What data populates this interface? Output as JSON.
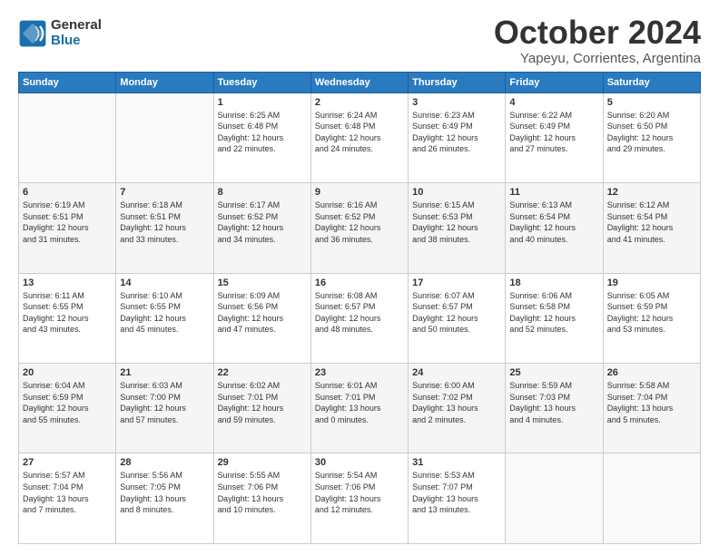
{
  "logo": {
    "general": "General",
    "blue": "Blue"
  },
  "title": "October 2024",
  "subtitle": "Yapeyu, Corrientes, Argentina",
  "header_days": [
    "Sunday",
    "Monday",
    "Tuesday",
    "Wednesday",
    "Thursday",
    "Friday",
    "Saturday"
  ],
  "weeks": [
    [
      {
        "day": "",
        "info": ""
      },
      {
        "day": "",
        "info": ""
      },
      {
        "day": "1",
        "info": "Sunrise: 6:25 AM\nSunset: 6:48 PM\nDaylight: 12 hours\nand 22 minutes."
      },
      {
        "day": "2",
        "info": "Sunrise: 6:24 AM\nSunset: 6:48 PM\nDaylight: 12 hours\nand 24 minutes."
      },
      {
        "day": "3",
        "info": "Sunrise: 6:23 AM\nSunset: 6:49 PM\nDaylight: 12 hours\nand 26 minutes."
      },
      {
        "day": "4",
        "info": "Sunrise: 6:22 AM\nSunset: 6:49 PM\nDaylight: 12 hours\nand 27 minutes."
      },
      {
        "day": "5",
        "info": "Sunrise: 6:20 AM\nSunset: 6:50 PM\nDaylight: 12 hours\nand 29 minutes."
      }
    ],
    [
      {
        "day": "6",
        "info": "Sunrise: 6:19 AM\nSunset: 6:51 PM\nDaylight: 12 hours\nand 31 minutes."
      },
      {
        "day": "7",
        "info": "Sunrise: 6:18 AM\nSunset: 6:51 PM\nDaylight: 12 hours\nand 33 minutes."
      },
      {
        "day": "8",
        "info": "Sunrise: 6:17 AM\nSunset: 6:52 PM\nDaylight: 12 hours\nand 34 minutes."
      },
      {
        "day": "9",
        "info": "Sunrise: 6:16 AM\nSunset: 6:52 PM\nDaylight: 12 hours\nand 36 minutes."
      },
      {
        "day": "10",
        "info": "Sunrise: 6:15 AM\nSunset: 6:53 PM\nDaylight: 12 hours\nand 38 minutes."
      },
      {
        "day": "11",
        "info": "Sunrise: 6:13 AM\nSunset: 6:54 PM\nDaylight: 12 hours\nand 40 minutes."
      },
      {
        "day": "12",
        "info": "Sunrise: 6:12 AM\nSunset: 6:54 PM\nDaylight: 12 hours\nand 41 minutes."
      }
    ],
    [
      {
        "day": "13",
        "info": "Sunrise: 6:11 AM\nSunset: 6:55 PM\nDaylight: 12 hours\nand 43 minutes."
      },
      {
        "day": "14",
        "info": "Sunrise: 6:10 AM\nSunset: 6:55 PM\nDaylight: 12 hours\nand 45 minutes."
      },
      {
        "day": "15",
        "info": "Sunrise: 6:09 AM\nSunset: 6:56 PM\nDaylight: 12 hours\nand 47 minutes."
      },
      {
        "day": "16",
        "info": "Sunrise: 6:08 AM\nSunset: 6:57 PM\nDaylight: 12 hours\nand 48 minutes."
      },
      {
        "day": "17",
        "info": "Sunrise: 6:07 AM\nSunset: 6:57 PM\nDaylight: 12 hours\nand 50 minutes."
      },
      {
        "day": "18",
        "info": "Sunrise: 6:06 AM\nSunset: 6:58 PM\nDaylight: 12 hours\nand 52 minutes."
      },
      {
        "day": "19",
        "info": "Sunrise: 6:05 AM\nSunset: 6:59 PM\nDaylight: 12 hours\nand 53 minutes."
      }
    ],
    [
      {
        "day": "20",
        "info": "Sunrise: 6:04 AM\nSunset: 6:59 PM\nDaylight: 12 hours\nand 55 minutes."
      },
      {
        "day": "21",
        "info": "Sunrise: 6:03 AM\nSunset: 7:00 PM\nDaylight: 12 hours\nand 57 minutes."
      },
      {
        "day": "22",
        "info": "Sunrise: 6:02 AM\nSunset: 7:01 PM\nDaylight: 12 hours\nand 59 minutes."
      },
      {
        "day": "23",
        "info": "Sunrise: 6:01 AM\nSunset: 7:01 PM\nDaylight: 13 hours\nand 0 minutes."
      },
      {
        "day": "24",
        "info": "Sunrise: 6:00 AM\nSunset: 7:02 PM\nDaylight: 13 hours\nand 2 minutes."
      },
      {
        "day": "25",
        "info": "Sunrise: 5:59 AM\nSunset: 7:03 PM\nDaylight: 13 hours\nand 4 minutes."
      },
      {
        "day": "26",
        "info": "Sunrise: 5:58 AM\nSunset: 7:04 PM\nDaylight: 13 hours\nand 5 minutes."
      }
    ],
    [
      {
        "day": "27",
        "info": "Sunrise: 5:57 AM\nSunset: 7:04 PM\nDaylight: 13 hours\nand 7 minutes."
      },
      {
        "day": "28",
        "info": "Sunrise: 5:56 AM\nSunset: 7:05 PM\nDaylight: 13 hours\nand 8 minutes."
      },
      {
        "day": "29",
        "info": "Sunrise: 5:55 AM\nSunset: 7:06 PM\nDaylight: 13 hours\nand 10 minutes."
      },
      {
        "day": "30",
        "info": "Sunrise: 5:54 AM\nSunset: 7:06 PM\nDaylight: 13 hours\nand 12 minutes."
      },
      {
        "day": "31",
        "info": "Sunrise: 5:53 AM\nSunset: 7:07 PM\nDaylight: 13 hours\nand 13 minutes."
      },
      {
        "day": "",
        "info": ""
      },
      {
        "day": "",
        "info": ""
      }
    ]
  ]
}
